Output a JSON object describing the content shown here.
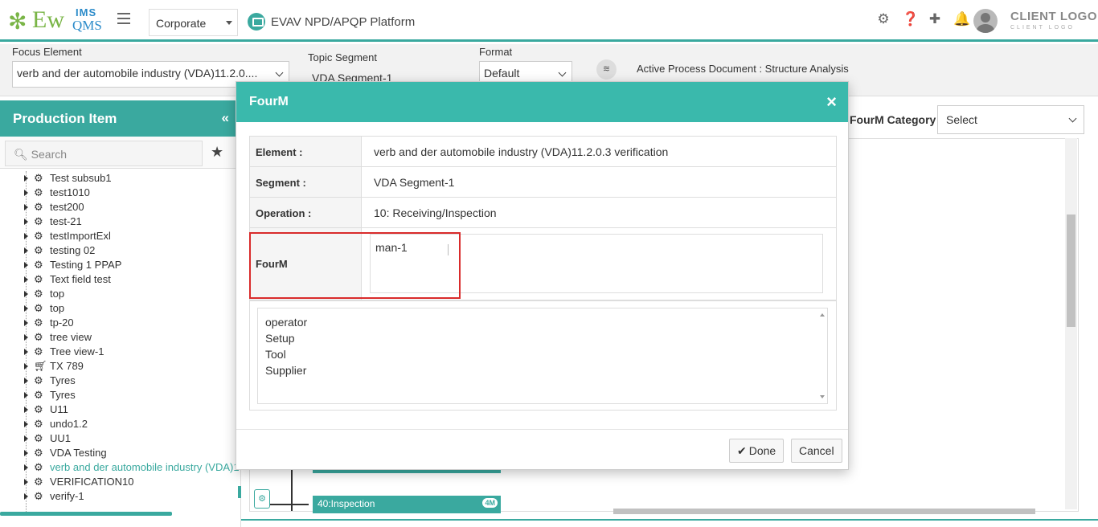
{
  "header": {
    "logo_main": "Ew",
    "logo_ims": "IMS",
    "logo_qms": "QMS",
    "org_select": "Corporate",
    "platform_title": "EVAV NPD/APQP Platform",
    "client_logo": "CLIENT LOGO",
    "client_logo_sub": "CLIENT LOGO",
    "icons": [
      "gear-icon",
      "help-icon",
      "plus-icon",
      "bell-icon",
      "user-avatar"
    ]
  },
  "filters": {
    "focus_element_label": "Focus Element",
    "focus_element_value": "verb and der automobile industry (VDA)11.2.0....",
    "topic_segment_label": "Topic Segment",
    "topic_segment_value": "VDA Segment-1",
    "format_label": "Format",
    "format_value": "Default",
    "active_doc": "Active Process Document : Structure Analysis"
  },
  "left_panel": {
    "title": "Production Item",
    "collapse": "«",
    "search_placeholder": "Search",
    "tree": [
      {
        "label": "Test subsub1",
        "icon": "gears"
      },
      {
        "label": "test1010",
        "icon": "gears"
      },
      {
        "label": "test200",
        "icon": "gears"
      },
      {
        "label": "test-21",
        "icon": "gears"
      },
      {
        "label": "testImportExl",
        "icon": "gears"
      },
      {
        "label": "testing 02",
        "icon": "gears"
      },
      {
        "label": "Testing 1 PPAP",
        "icon": "gears"
      },
      {
        "label": "Text field test",
        "icon": "gears"
      },
      {
        "label": "top",
        "icon": "gears"
      },
      {
        "label": "top",
        "icon": "gears"
      },
      {
        "label": "tp-20",
        "icon": "gears"
      },
      {
        "label": "tree view",
        "icon": "gears"
      },
      {
        "label": "Tree view-1",
        "icon": "gears"
      },
      {
        "label": "TX 789",
        "icon": "cart"
      },
      {
        "label": "Tyres",
        "icon": "gears"
      },
      {
        "label": "Tyres",
        "icon": "gears"
      },
      {
        "label": "U11",
        "icon": "gears"
      },
      {
        "label": "undo1.2",
        "icon": "gears"
      },
      {
        "label": "UU1",
        "icon": "gears"
      },
      {
        "label": "VDA Testing",
        "icon": "gears"
      },
      {
        "label": "verb and der automobile industry (VDA)1",
        "icon": "gears",
        "selected": true
      },
      {
        "label": "VERIFICATION10",
        "icon": "gears"
      },
      {
        "label": "verify-1",
        "icon": "gears"
      }
    ]
  },
  "right": {
    "fourm_category_label": "FourM Category",
    "fourm_category_value": "Select",
    "process_box_label": "40:Inspection",
    "process_badge": "4M"
  },
  "modal": {
    "title": "FourM",
    "close": "×",
    "element_label": "Element :",
    "element_value": "verb and der automobile industry (VDA)11.2.0.3 verification",
    "segment_label": "Segment :",
    "segment_value": "VDA Segment-1",
    "operation_label": "Operation :",
    "operation_value": "10: Receiving/Inspection",
    "fourm_label": "FourM",
    "fourm_value": "man-1",
    "options": [
      "operator",
      "Setup",
      "Tool",
      "Supplier"
    ],
    "done_label": "Done",
    "cancel_label": "Cancel"
  },
  "colors": {
    "accent": "#3aa99f",
    "modal_header": "#3ab9ac",
    "highlight": "#d92b2b"
  }
}
